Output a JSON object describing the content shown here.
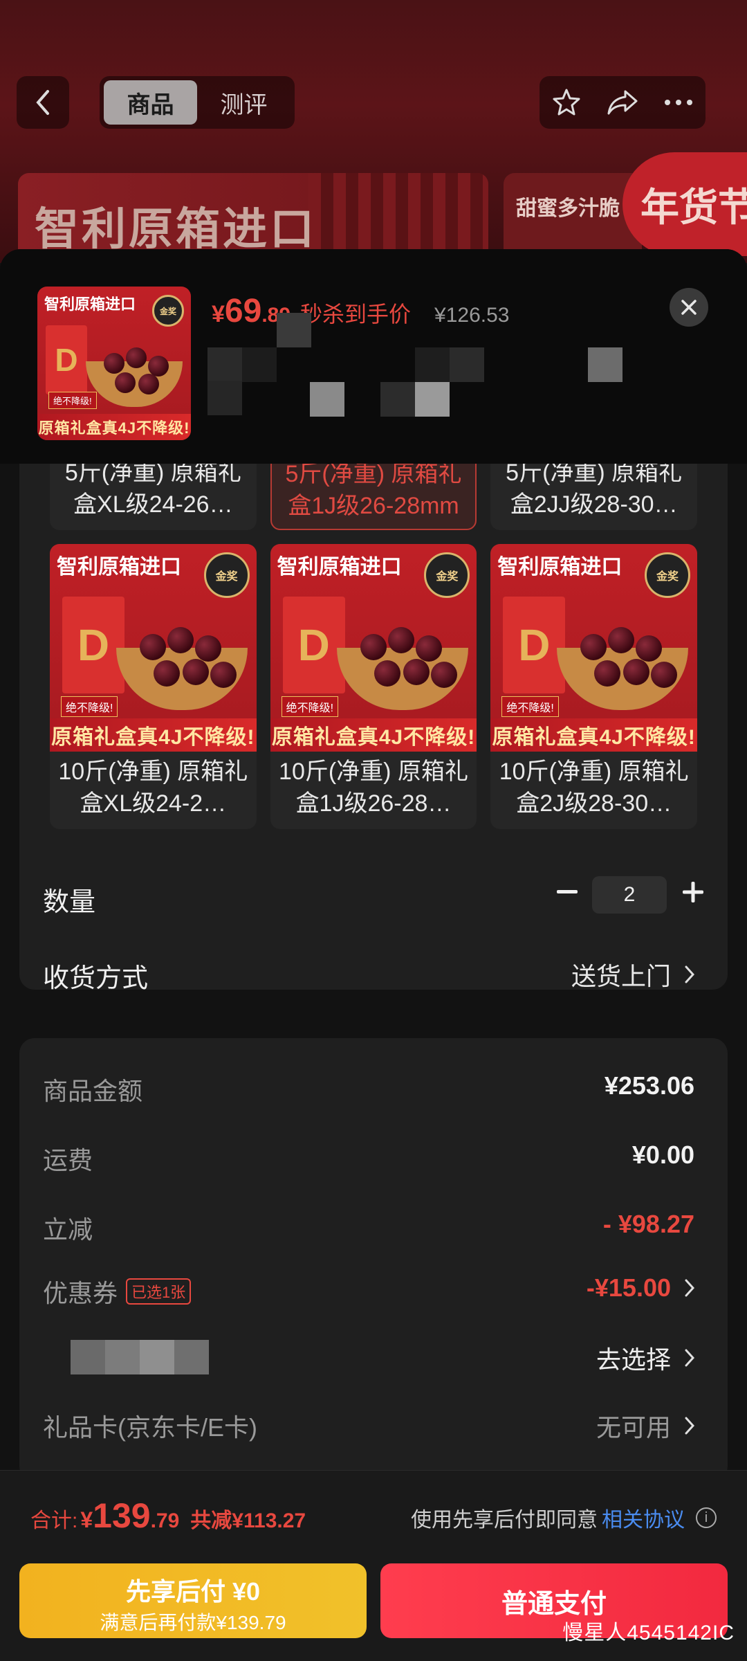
{
  "header": {
    "tabs": [
      "商品",
      "测评"
    ],
    "active_tab": 0
  },
  "background": {
    "banner_title": "智利原箱进口",
    "banner2_title": "甜蜜多汁脆",
    "festival_badge": "年货节"
  },
  "product_summary": {
    "thumb_title": "智利原箱进口",
    "thumb_footer": "原箱礼盒真4J不降级!",
    "price_currency": "¥",
    "price_int": "69",
    "price_dec": ".89",
    "price_tag": "秒杀到手价",
    "original_price": "¥126.53"
  },
  "variants_row1": [
    {
      "label": "5斤(净重) 原箱礼盒XL级24-26…",
      "selected": false
    },
    {
      "label": "5斤(净重) 原箱礼盒1J级26-28mm",
      "selected": true
    },
    {
      "label": "5斤(净重) 原箱礼盒2JJ级28-30…",
      "selected": false
    }
  ],
  "variants_row2": [
    {
      "label": "10斤(净重) 原箱礼盒XL级24-2…",
      "img_title": "智利原箱进口",
      "img_footer": "原箱礼盒真4J不降级!",
      "seal": "金奖",
      "tag": "绝不降级!"
    },
    {
      "label": "10斤(净重) 原箱礼盒1J级26-28…",
      "img_title": "智利原箱进口",
      "img_footer": "原箱礼盒真4J不降级!",
      "seal": "金奖",
      "tag": "绝不降级!"
    },
    {
      "label": "10斤(净重) 原箱礼盒2J级28-30…",
      "img_title": "智利原箱进口",
      "img_footer": "原箱礼盒真4J不降级!",
      "seal": "金奖",
      "tag": "绝不降级!"
    }
  ],
  "quantity": {
    "label": "数量",
    "value": "2"
  },
  "delivery": {
    "label": "收货方式",
    "value": "送货上门"
  },
  "pricing": {
    "goods_label": "商品金额",
    "goods_value": "¥253.06",
    "shipping_label": "运费",
    "shipping_value": "¥0.00",
    "discount_label": "立减",
    "discount_value": "- ¥98.27",
    "coupon_label": "优惠券",
    "coupon_badge": "已选1张",
    "coupon_value": "-¥15.00",
    "select_value": "去选择",
    "giftcard_label": "礼品卡(京东卡/E卡)",
    "giftcard_value": "无可用"
  },
  "bottom": {
    "total_label": "合计:",
    "total_currency": "¥",
    "total_int": "139",
    "total_dec": ".79",
    "total_saved": "共减¥113.27",
    "agreement_prefix": "使用先享后付即同意",
    "agreement_link": "相关协议",
    "btn_later_line1": "先享后付 ¥0",
    "btn_later_line2": "满意后再付款¥139.79",
    "btn_pay": "普通支付",
    "watermark": "慢星人4545142IC"
  },
  "colors": {
    "accent_red": "#e8483f",
    "link_blue": "#4a8cf0",
    "later_yellow": "#f2b21f",
    "pay_red": "#ff3d4e"
  }
}
